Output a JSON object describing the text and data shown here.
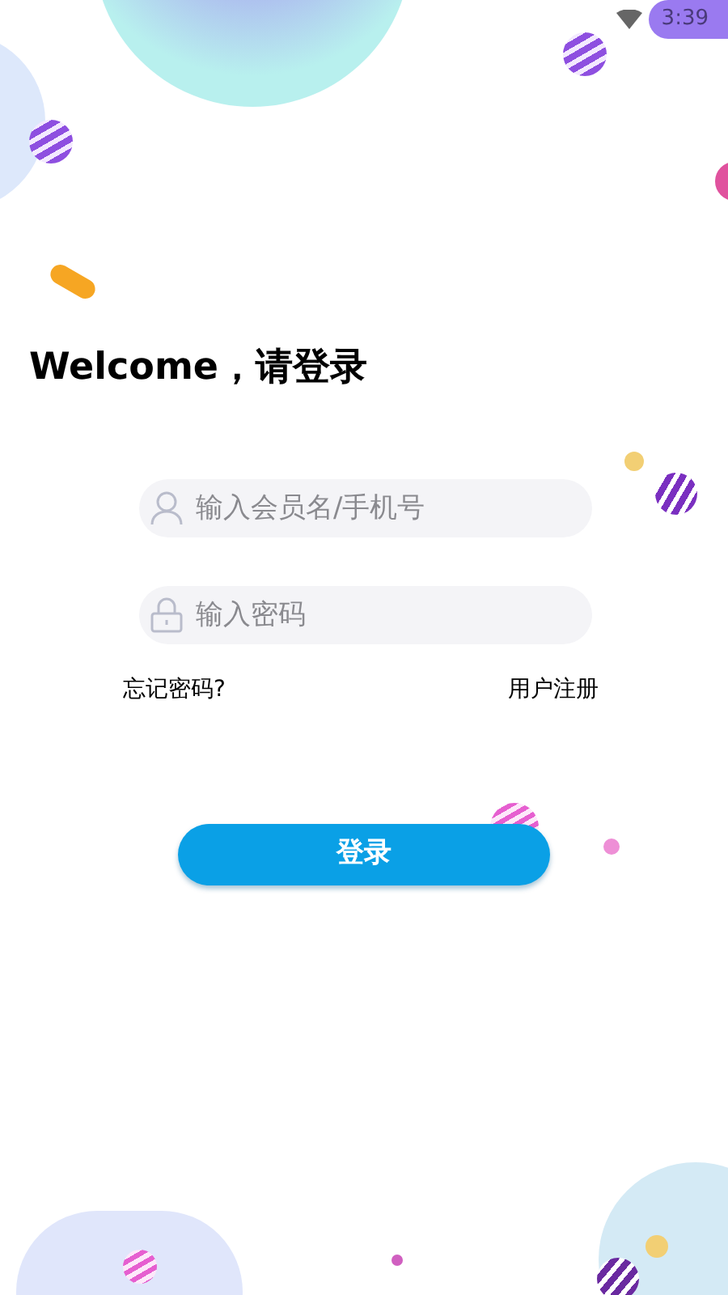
{
  "status_bar": {
    "time": "3:39"
  },
  "title": "Welcome，请登录",
  "fields": [
    {
      "kind": "user",
      "placeholder": "输入会员名/手机号"
    },
    {
      "kind": "password",
      "placeholder": "输入密码"
    }
  ],
  "links": [
    "忘记密码?",
    "用户注册"
  ],
  "login_button": "登录"
}
